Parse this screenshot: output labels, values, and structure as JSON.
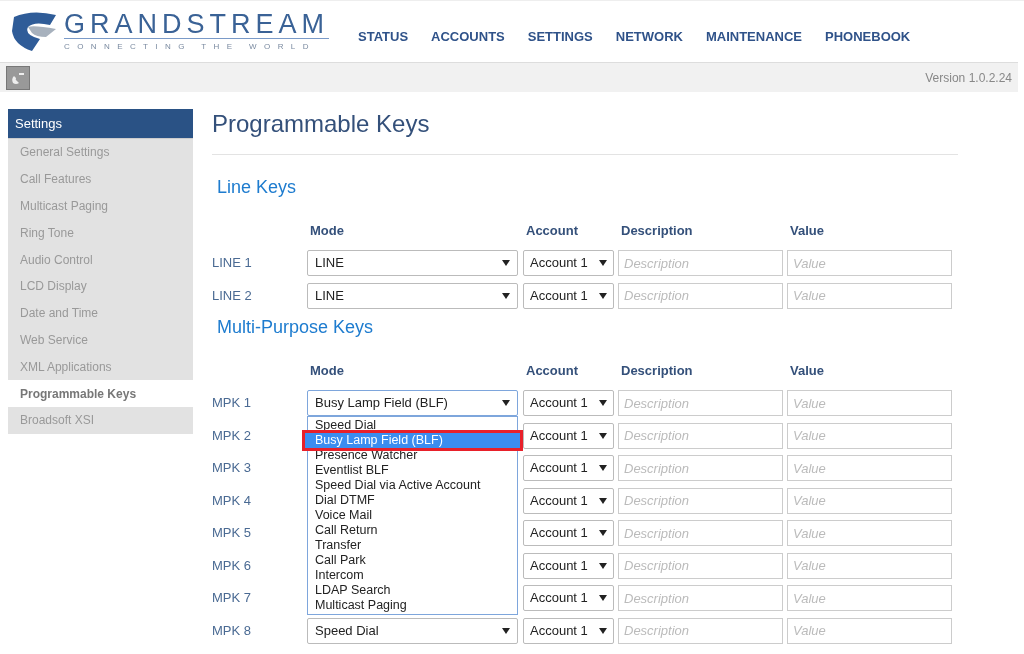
{
  "header": {
    "logo": {
      "name": "GRANDSTREAM",
      "tagline": "CONNECTING THE WORLD"
    },
    "nav": [
      {
        "label": "STATUS"
      },
      {
        "label": "ACCOUNTS"
      },
      {
        "label": "SETTINGS"
      },
      {
        "label": "NETWORK"
      },
      {
        "label": "MAINTENANCE"
      },
      {
        "label": "PHONEBOOK"
      }
    ]
  },
  "toolbar": {
    "version": "Version 1.0.2.24"
  },
  "sidebar": {
    "title": "Settings",
    "items": [
      {
        "label": "General Settings",
        "selected": false
      },
      {
        "label": "Call Features",
        "selected": false
      },
      {
        "label": "Multicast Paging",
        "selected": false
      },
      {
        "label": "Ring Tone",
        "selected": false
      },
      {
        "label": "Audio Control",
        "selected": false
      },
      {
        "label": "LCD Display",
        "selected": false
      },
      {
        "label": "Date and Time",
        "selected": false
      },
      {
        "label": "Web Service",
        "selected": false
      },
      {
        "label": "XML Applications",
        "selected": false
      },
      {
        "label": "Programmable Keys",
        "selected": true
      },
      {
        "label": "Broadsoft XSI",
        "selected": false
      }
    ]
  },
  "page_title": "Programmable Keys",
  "sections": [
    {
      "title": "Line Keys",
      "columns": [
        "Mode",
        "Account",
        "Description",
        "Value"
      ],
      "rows": [
        {
          "label": "LINE 1",
          "mode": "LINE",
          "account": "Account 1",
          "description_placeholder": "Description",
          "value_placeholder": "Value"
        },
        {
          "label": "LINE 2",
          "mode": "LINE",
          "account": "Account 1",
          "description_placeholder": "Description",
          "value_placeholder": "Value"
        }
      ]
    },
    {
      "title": "Multi-Purpose Keys",
      "columns": [
        "Mode",
        "Account",
        "Description",
        "Value"
      ],
      "rows": [
        {
          "label": "MPK 1",
          "mode": "Busy Lamp Field (BLF)",
          "account": "Account 1",
          "description_placeholder": "Description",
          "value_placeholder": "Value",
          "open": true,
          "options": [
            {
              "label": "Speed Dial",
              "selected": false
            },
            {
              "label": "Busy Lamp Field (BLF)",
              "selected": true
            },
            {
              "label": "Presence Watcher",
              "selected": false
            },
            {
              "label": "Eventlist BLF",
              "selected": false
            },
            {
              "label": "Speed Dial via Active Account",
              "selected": false
            },
            {
              "label": "Dial DTMF",
              "selected": false
            },
            {
              "label": "Voice Mail",
              "selected": false
            },
            {
              "label": "Call Return",
              "selected": false
            },
            {
              "label": "Transfer",
              "selected": false
            },
            {
              "label": "Call Park",
              "selected": false
            },
            {
              "label": "Intercom",
              "selected": false
            },
            {
              "label": "LDAP Search",
              "selected": false
            },
            {
              "label": "Multicast Paging",
              "selected": false
            }
          ]
        },
        {
          "label": "MPK 2",
          "account": "Account 1",
          "description_placeholder": "Description",
          "value_placeholder": "Value"
        },
        {
          "label": "MPK 3",
          "account": "Account 1",
          "description_placeholder": "Description",
          "value_placeholder": "Value"
        },
        {
          "label": "MPK 4",
          "account": "Account 1",
          "description_placeholder": "Description",
          "value_placeholder": "Value"
        },
        {
          "label": "MPK 5",
          "account": "Account 1",
          "description_placeholder": "Description",
          "value_placeholder": "Value"
        },
        {
          "label": "MPK 6",
          "account": "Account 1",
          "description_placeholder": "Description",
          "value_placeholder": "Value"
        },
        {
          "label": "MPK 7",
          "account": "Account 1",
          "description_placeholder": "Description",
          "value_placeholder": "Value"
        },
        {
          "label": "MPK 8",
          "mode": "Speed Dial",
          "account": "Account 1",
          "description_placeholder": "Description",
          "value_placeholder": "Value"
        }
      ]
    }
  ]
}
